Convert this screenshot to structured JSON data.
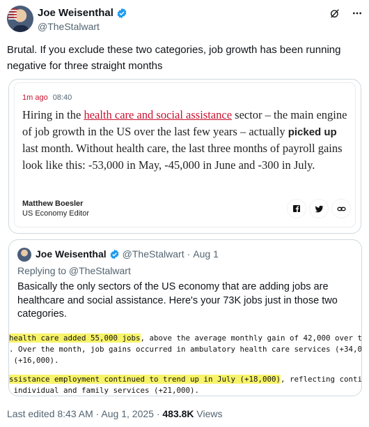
{
  "tweet": {
    "author_name": "Joe Weisenthal",
    "author_handle": "@TheStalwart",
    "text": "Brutal. If you exclude these two categories, job growth has been running negative for three straight months"
  },
  "card": {
    "time_ago": "1m ago",
    "time": "08:40",
    "body_pre": "Hiring in the ",
    "body_link": "health care and social assistance",
    "body_mid": " sector – the main engine of job growth in the US over the last few years – actually ",
    "body_bold": "picked up",
    "body_post": " last month. Without health care, the last three months of payroll gains look like this: -53,000 in May, -45,000 in June and -300 in July.",
    "author": "Matthew Boesler",
    "author_role": "US Economy Editor"
  },
  "quote": {
    "author_name": "Joe Weisenthal",
    "author_handle": "@TheStalwart",
    "dot": "·",
    "date": "Aug 1",
    "replying_to": "Replying to @TheStalwart",
    "text": "Basically the only sectors of the US economy that are adding jobs are healthcare and social assistance. Here's your 73K jobs just in those two categories.",
    "clip_lines": [
      {
        "hl": "health care added 55,000 jobs",
        "rest": ", above the average monthly gain of 42,000 over th"
      },
      {
        "hl": "",
        "rest": ". Over the month, job gains occurred in ambulatory health care services (+34,00"
      },
      {
        "hl": "",
        "rest": " (+16,000)."
      },
      {
        "hl": "ssistance employment continued to trend up in July (+18,000)",
        "rest": ", reflecting continu"
      },
      {
        "hl": "",
        "rest": " individual and family services (+21,000)."
      }
    ]
  },
  "footer": {
    "edited": "Last edited 8:43 AM · Aug 1, 2025 · ",
    "views_count": "483.8K",
    "views_label": " Views"
  },
  "colors": {
    "link_red": "#c8102e",
    "verified_blue": "#1d9bf0",
    "highlight": "#f7f36a"
  },
  "icons": [
    "verified-badge-icon",
    "grok-icon",
    "more-icon",
    "facebook-icon",
    "twitter-icon",
    "link-icon"
  ]
}
